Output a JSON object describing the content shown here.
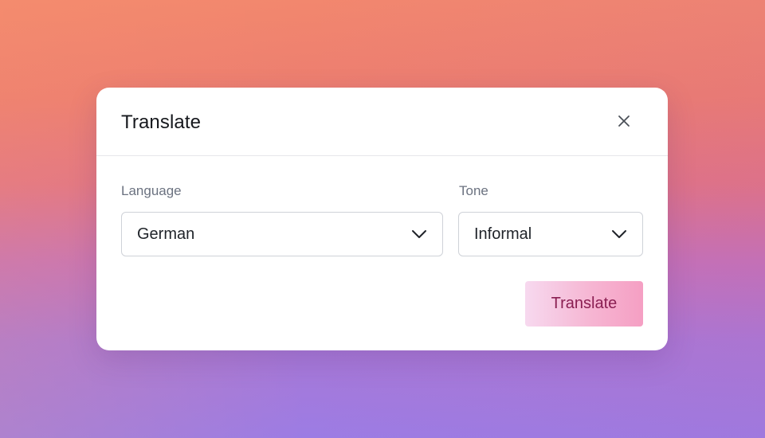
{
  "dialog": {
    "title": "Translate",
    "close_icon": "close-icon"
  },
  "language": {
    "label": "Language",
    "value": "German",
    "icon": "chevron-down-icon"
  },
  "tone": {
    "label": "Tone",
    "value": "Informal",
    "icon": "chevron-down-icon"
  },
  "actions": {
    "translate_label": "Translate"
  },
  "colors": {
    "button_text": "#8a1f52",
    "button_gradient_start": "#f7d9ef",
    "button_gradient_end": "#f59fc3",
    "title_text": "#16181d",
    "label_text": "#6b7280"
  }
}
